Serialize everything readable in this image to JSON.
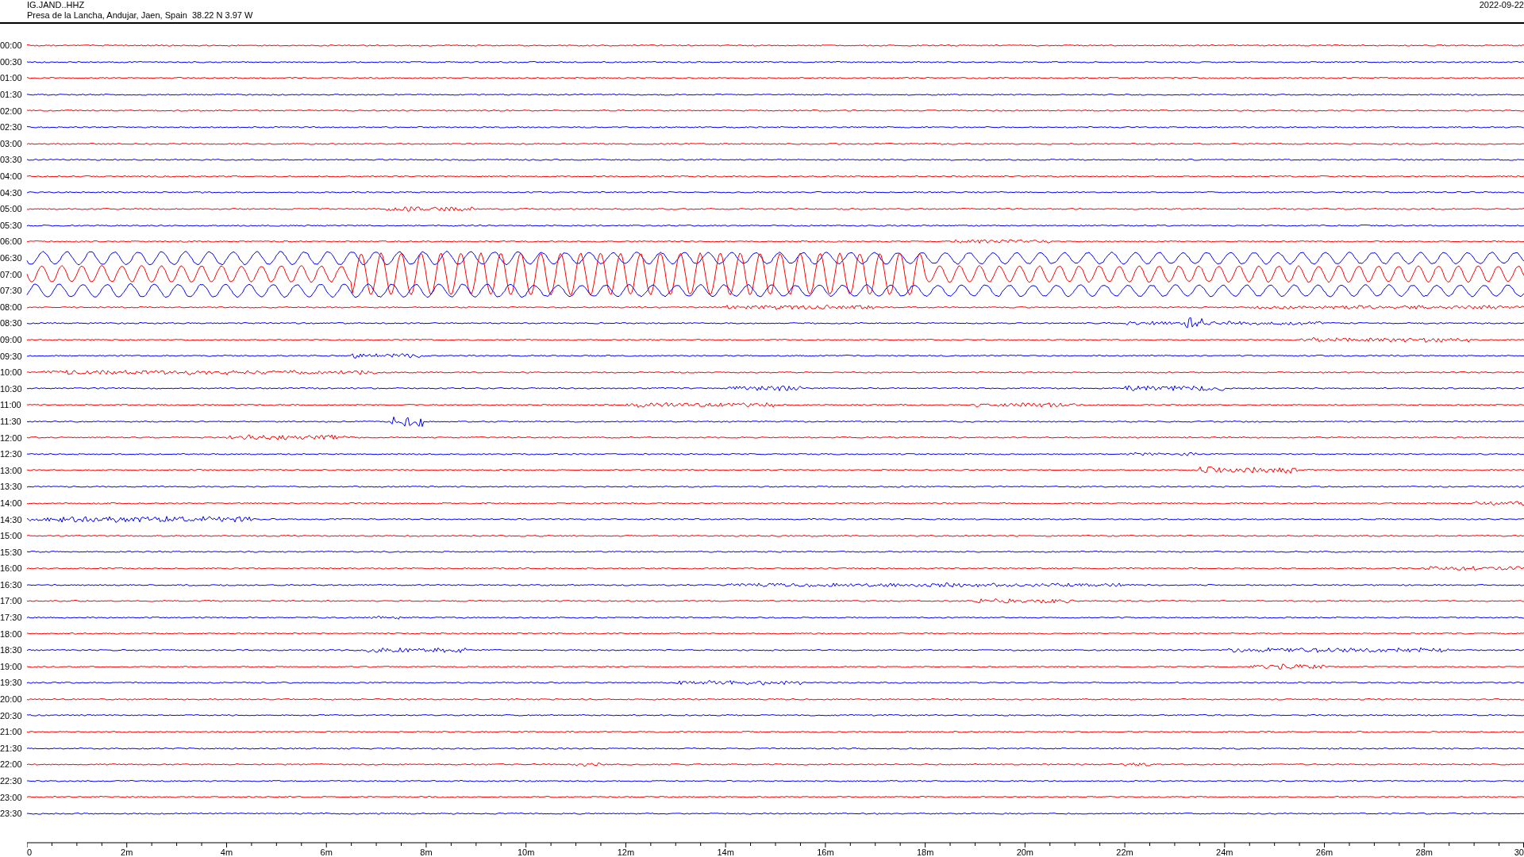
{
  "header": {
    "station": "IG.JAND..HHZ",
    "location": "Presa de la Lancha, Andujar, Jaen, Spain  38.22 N 3.97 W",
    "date": "2022-09-22"
  },
  "rows": [
    {
      "label": "00:00",
      "color": "#ff0000"
    },
    {
      "label": "00:30",
      "color": "#0000ff"
    },
    {
      "label": "01:00",
      "color": "#ff0000"
    },
    {
      "label": "01:30",
      "color": "#0000ff"
    },
    {
      "label": "02:00",
      "color": "#ff0000"
    },
    {
      "label": "02:30",
      "color": "#0000ff"
    },
    {
      "label": "03:00",
      "color": "#ff0000"
    },
    {
      "label": "03:30",
      "color": "#0000ff"
    },
    {
      "label": "04:00",
      "color": "#ff0000"
    },
    {
      "label": "04:30",
      "color": "#0000ff"
    },
    {
      "label": "05:00",
      "color": "#ff0000"
    },
    {
      "label": "05:30",
      "color": "#0000ff"
    },
    {
      "label": "06:00",
      "color": "#ff0000"
    },
    {
      "label": "06:30",
      "color": "#0000ff"
    },
    {
      "label": "07:00",
      "color": "#ff0000"
    },
    {
      "label": "07:30",
      "color": "#0000ff"
    },
    {
      "label": "08:00",
      "color": "#ff0000"
    },
    {
      "label": "08:30",
      "color": "#0000ff"
    },
    {
      "label": "09:00",
      "color": "#ff0000"
    },
    {
      "label": "09:30",
      "color": "#0000ff"
    },
    {
      "label": "10:00",
      "color": "#ff0000"
    },
    {
      "label": "10:30",
      "color": "#0000ff"
    },
    {
      "label": "11:00",
      "color": "#ff0000"
    },
    {
      "label": "11:30",
      "color": "#0000ff"
    },
    {
      "label": "12:00",
      "color": "#ff0000"
    },
    {
      "label": "12:30",
      "color": "#0000ff"
    },
    {
      "label": "13:00",
      "color": "#ff0000"
    },
    {
      "label": "13:30",
      "color": "#0000ff"
    },
    {
      "label": "14:00",
      "color": "#ff0000"
    },
    {
      "label": "14:30",
      "color": "#0000ff"
    },
    {
      "label": "15:00",
      "color": "#ff0000"
    },
    {
      "label": "15:30",
      "color": "#0000ff"
    },
    {
      "label": "16:00",
      "color": "#ff0000"
    },
    {
      "label": "16:30",
      "color": "#0000ff"
    },
    {
      "label": "17:00",
      "color": "#ff0000"
    },
    {
      "label": "17:30",
      "color": "#0000ff"
    },
    {
      "label": "18:00",
      "color": "#ff0000"
    },
    {
      "label": "18:30",
      "color": "#0000ff"
    },
    {
      "label": "19:00",
      "color": "#ff0000"
    },
    {
      "label": "19:30",
      "color": "#0000ff"
    },
    {
      "label": "20:00",
      "color": "#ff0000"
    },
    {
      "label": "20:30",
      "color": "#0000ff"
    },
    {
      "label": "21:00",
      "color": "#ff0000"
    },
    {
      "label": "21:30",
      "color": "#0000ff"
    },
    {
      "label": "22:00",
      "color": "#ff0000"
    },
    {
      "label": "22:30",
      "color": "#0000ff"
    },
    {
      "label": "23:00",
      "color": "#ff0000"
    },
    {
      "label": "23:30",
      "color": "#0000ff"
    }
  ],
  "axis": {
    "ticks": [
      "0",
      "2m",
      "4m",
      "6m",
      "8m",
      "10m",
      "12m",
      "14m",
      "16m",
      "18m",
      "20m",
      "22m",
      "24m",
      "26m",
      "28m",
      "30"
    ]
  }
}
